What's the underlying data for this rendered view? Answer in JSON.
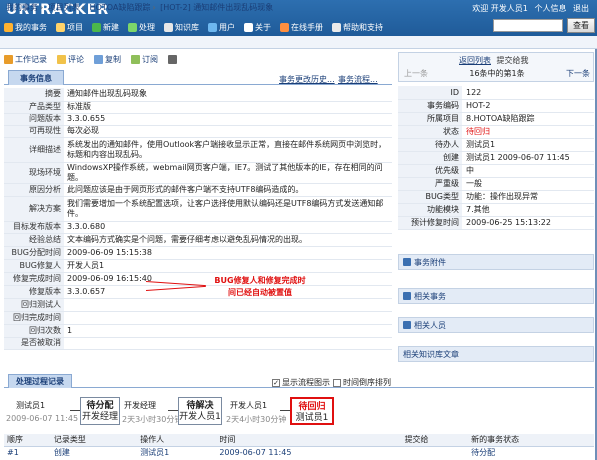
{
  "app": {
    "logo": "URTRACKER",
    "welcome": "欢迎 开发人员1",
    "personal_info": "个人信息",
    "logout": "退出"
  },
  "nav": [
    {
      "label": "我的事务",
      "icon": "home-icon",
      "color": "#ffb230"
    },
    {
      "label": "项目",
      "icon": "project-icon",
      "color": "#ffd36a"
    },
    {
      "label": "新建",
      "icon": "new-icon",
      "color": "#4bb74b"
    },
    {
      "label": "处理",
      "icon": "check-icon",
      "color": "#7cd66a"
    },
    {
      "label": "知识库",
      "icon": "knowledge-icon",
      "color": "#e7e7e7"
    },
    {
      "label": "用户",
      "icon": "user-icon",
      "color": "#6db7ef"
    },
    {
      "label": "关于",
      "icon": "info-icon",
      "color": "#ffffff"
    },
    {
      "label": "在线手册",
      "icon": "manual-icon",
      "color": "#ff8f3f"
    },
    {
      "label": "帮助和支持",
      "icon": "help-icon",
      "color": "#eaeaea"
    }
  ],
  "search": {
    "button": "查看"
  },
  "breadcrumb": [
    "我的事务",
    "项目列表",
    "HOTOA缺陷跟踪",
    "[HOT-2] 通知邮件出现乱码现象"
  ],
  "toolbar": [
    {
      "label": "工作记录",
      "icon": "worklog-icon",
      "color": "#e89c2a"
    },
    {
      "label": "评论",
      "icon": "comment-icon",
      "color": "#f1c24a"
    },
    {
      "label": "复制",
      "icon": "copy-icon",
      "color": "#6f9fd8"
    },
    {
      "label": "订阅",
      "icon": "subscribe-icon",
      "color": "#8fbf5a"
    },
    {
      "label": "",
      "icon": "print-icon",
      "color": "#666666"
    }
  ],
  "tabs": {
    "info": "事务信息",
    "change_history": "事务更改历史...",
    "process": "事务流程..."
  },
  "info_rows": [
    {
      "label": "摘要",
      "value": "通知邮件出现乱码现象"
    },
    {
      "label": "产品类型",
      "value": "标准版"
    },
    {
      "label": "问题版本",
      "value": "3.3.0.655"
    },
    {
      "label": "可再现性",
      "value": "每次必现"
    },
    {
      "label": "详细描述",
      "value": "系统发出的通知邮件，使用Outlook客户端接收显示正常，直接在邮件系统网页中浏览时，标题和内容出现乱码。"
    },
    {
      "label": "现场环境",
      "value": "WindowsXP操作系统，webmail网页客户端，IE7。测试了其他版本的IE，存在相同的问题。"
    },
    {
      "label": "原因分析",
      "value": "此问题应该是由于网页形式的邮件客户端不支持UTF8编码造成的。"
    },
    {
      "label": "解决方案",
      "value": "我们需要增加一个系统配置选项，让客户选择使用默认编码还是UTF8编码方式发送通知邮件。"
    },
    {
      "label": "目标发布版本",
      "value": "3.3.0.680"
    },
    {
      "label": "经验总结",
      "value": "文本编码方式确实是个问题，需要仔细考虑以避免乱码情况的出现。"
    },
    {
      "label": "BUG分配时间",
      "value": "2009-06-09 15:15:38"
    },
    {
      "label": "BUG修复人",
      "value": "开发人员1"
    },
    {
      "label": "修复完成时间",
      "value": "2009-06-09 16:15:40"
    },
    {
      "label": "修复版本",
      "value": "3.3.0.657"
    },
    {
      "label": "回归测试人",
      "value": ""
    },
    {
      "label": "回归完成时间",
      "value": ""
    },
    {
      "label": "回归次数",
      "value": "1"
    },
    {
      "label": "是否被取消",
      "value": ""
    }
  ],
  "annotation": {
    "line1": "BUG修复人和修复完成时",
    "line2": "间已经自动被置值"
  },
  "right_panel": {
    "back": "返回列表",
    "submitted_to": "提交给我",
    "prev": "上一条",
    "position": "16条中的第1条",
    "next": "下一条"
  },
  "side_rows": [
    {
      "label": "ID",
      "value": "122"
    },
    {
      "label": "事务编码",
      "value": "HOT-2"
    },
    {
      "label": "所属项目",
      "value": "8.HOTOA缺陷跟踪"
    },
    {
      "label": "状态",
      "value": "待回归",
      "color": "#e01010"
    },
    {
      "label": "待办人",
      "value": "测试员1"
    },
    {
      "label": "创建",
      "value": "测试员1 2009-06-07 11:45"
    },
    {
      "label": "优先级",
      "value": "中"
    },
    {
      "label": "严重级",
      "value": "一般"
    },
    {
      "label": "BUG类型",
      "value": "功能：操作出现异常"
    },
    {
      "label": "功能模块",
      "value": "7.其他"
    },
    {
      "label": "预计修复时间",
      "value": "2009-06-25 15:13:22"
    }
  ],
  "side_panels": [
    "事务附件",
    "相关事务",
    "相关人员",
    "相关知识库文章"
  ],
  "process": {
    "tab": "处理过程记录",
    "show_flow": "显示流程图示",
    "time_desc": "时间倒序排列"
  },
  "flow": [
    {
      "top": "测试员1",
      "bottom": "2009-06-07 11:45"
    },
    {
      "top": "待分配",
      "bottom": "开发经理"
    },
    {
      "top": "开发经理",
      "bottom": "2天3小时30分钟"
    },
    {
      "top": "待解决",
      "bottom": "开发人员1"
    },
    {
      "top": "开发人员1",
      "bottom": "2天4小时30分钟"
    },
    {
      "top": "待回归",
      "bottom": "测试员1"
    }
  ],
  "history": {
    "headers": [
      "顺序",
      "记录类型",
      "操作人",
      "时间",
      "提交给",
      "新的事务状态"
    ],
    "first_row": [
      "#1",
      "创建",
      "测试员1",
      "2009-06-07 11:45",
      "",
      "待分配"
    ]
  }
}
